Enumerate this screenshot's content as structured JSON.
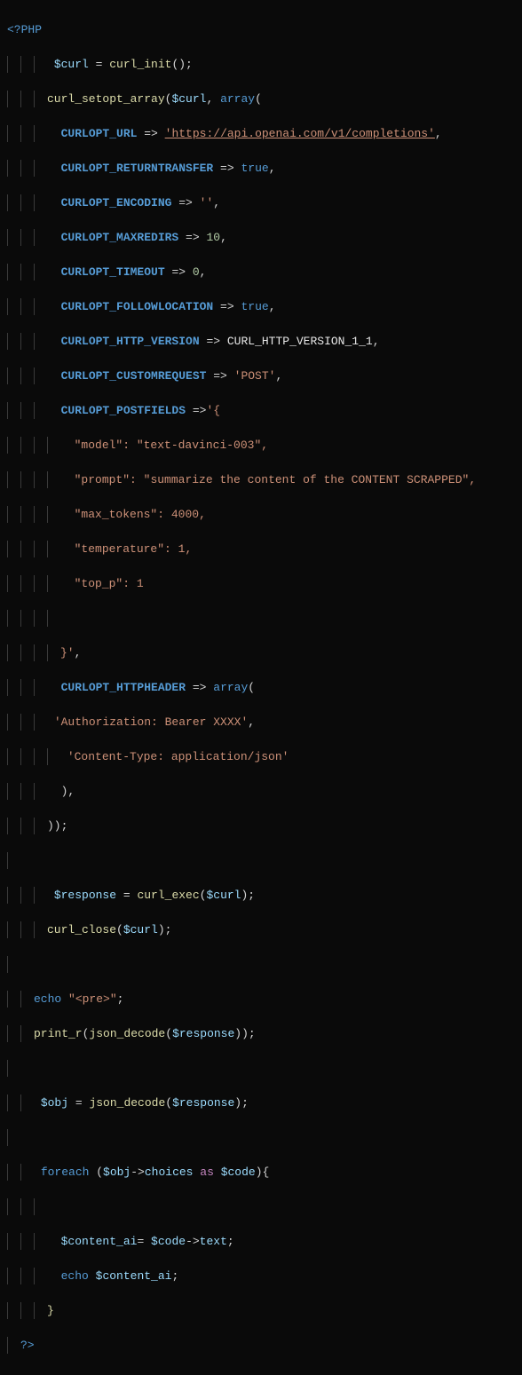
{
  "code": {
    "open_tag": "<?PHP",
    "close_tag": "?>",
    "l01_var": "$curl",
    "l01_fn": "curl_init",
    "l02_fn": "curl_setopt_array",
    "l02_arg1": "$curl",
    "l02_kw": "array",
    "c_url": "CURLOPT_URL",
    "url_str": "'https://api.openai.com/v1/completions'",
    "c_rt": "CURLOPT_RETURNTRANSFER",
    "v_true": "true",
    "c_enc": "CURLOPT_ENCODING",
    "v_empty": "''",
    "c_mr": "CURLOPT_MAXREDIRS",
    "v_10": "10",
    "c_to": "CURLOPT_TIMEOUT",
    "v_0": "0",
    "c_fl": "CURLOPT_FOLLOWLOCATION",
    "c_hv": "CURLOPT_HTTP_VERSION",
    "v_hv": "CURL_HTTP_VERSION_1_1",
    "c_cr": "CURLOPT_CUSTOMREQUEST",
    "v_post": "'POST'",
    "c_pf": "CURLOPT_POSTFIELDS",
    "pf_open": "'{",
    "jk_model": "\"model\"",
    "jv_model": "\"text-davinci-003\"",
    "jk_prompt": "\"prompt\"",
    "jv_prompt": "\"summarize the content of the CONTENT SCRAPPED\"",
    "jk_max": "\"max_tokens\"",
    "jv_max": "4000",
    "jk_temp": "\"temperature\"",
    "jv_temp": "1",
    "jk_top": "\"top_p\"",
    "jv_top": "1",
    "pf_close": "}'",
    "c_hh": "CURLOPT_HTTPHEADER",
    "hh_auth": "'Authorization: Bearer XXXX'",
    "hh_ct": "'Content-Type: application/json'",
    "resp_var": "$response",
    "resp_fn": "curl_exec",
    "cc_fn": "curl_close",
    "echo_kw": "echo",
    "pre_str": "\"<pre>\"",
    "pr_fn": "print_r",
    "jd_fn": "json_decode",
    "obj_var": "$obj",
    "foreach_kw": "foreach",
    "choices_prop": "choices",
    "as_kw": "as",
    "code_var": "$code",
    "cai_var": "$content_ai",
    "text_prop": "text"
  }
}
